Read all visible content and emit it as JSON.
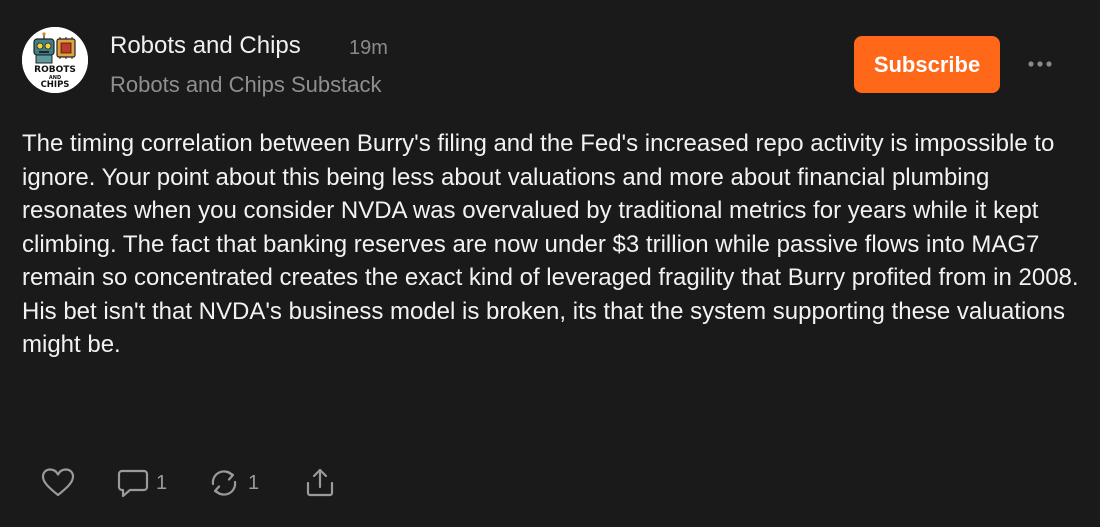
{
  "post": {
    "publication_name": "Robots and Chips",
    "time_ago": "19m",
    "subtitle": "Robots and Chips Substack",
    "avatar_logo_text": "ROBOTS AND CHIPS",
    "subscribe_label": "Subscribe",
    "body": "The timing correlation between Burry's filing and the Fed's increased repo activity is impossible to ignore. Your point about this being less about valuations and more about financial plumbing resonates when you consider NVDA was overvalued by traditional metrics for years while it kept climbing. The fact that banking reserves are now under $3 trillion while passive flows into MAG7 remain so concentrated creates the exact kind of leveraged fragility that Burry profited from in 2008. His bet isn't that NVDA's business model is broken, its that the system supporting these valuations might be."
  },
  "actions": {
    "like": {
      "icon": "heart-icon"
    },
    "comment": {
      "icon": "comment-icon",
      "count": "1"
    },
    "restack": {
      "icon": "restack-icon",
      "count": "1"
    },
    "share": {
      "icon": "share-icon"
    }
  },
  "colors": {
    "background": "#1a1a1b",
    "accent": "#ff6719",
    "text": "#f2f2f2",
    "muted": "#8f8f8f"
  }
}
